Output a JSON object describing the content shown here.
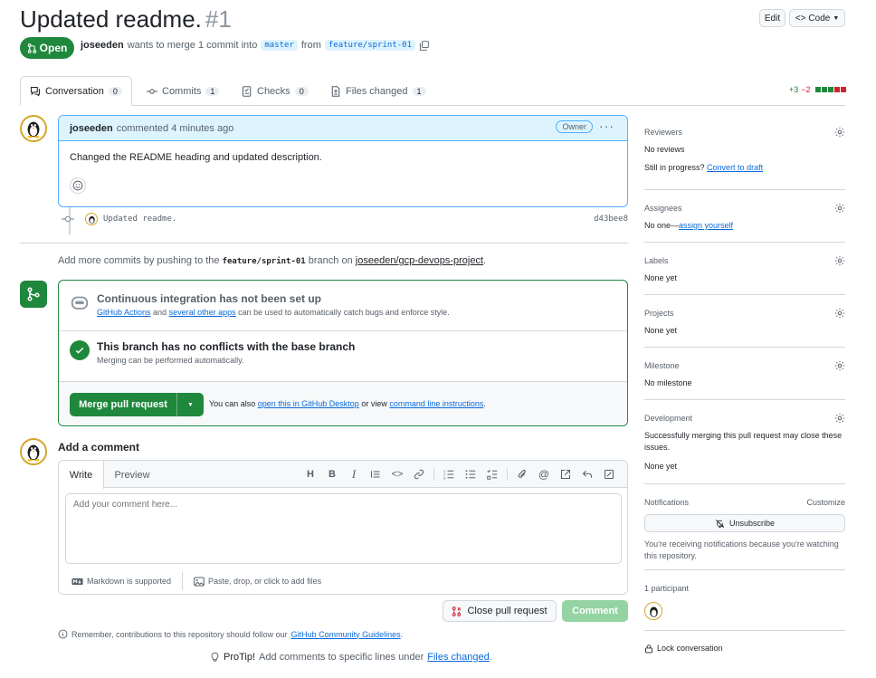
{
  "header": {
    "title": "Updated readme.",
    "number": "#1",
    "edit_label": "Edit",
    "code_label": "Code",
    "state": "Open",
    "author": "joseeden",
    "merge_text_1": "wants to merge 1 commit into",
    "base_branch": "master",
    "merge_text_2": "from",
    "head_branch": "feature/sprint-01"
  },
  "tabs": [
    {
      "label": "Conversation",
      "count": "0"
    },
    {
      "label": "Commits",
      "count": "1"
    },
    {
      "label": "Checks",
      "count": "0"
    },
    {
      "label": "Files changed",
      "count": "1"
    }
  ],
  "diffstat": {
    "additions": "+3",
    "deletions": "−2"
  },
  "comment": {
    "author": "joseeden",
    "time": "commented 4 minutes ago",
    "badge": "Owner",
    "body": "Changed the README heading and updated description."
  },
  "commit": {
    "message": "Updated readme.",
    "sha": "d43bee8"
  },
  "push_note": {
    "text_1": "Add more commits by pushing to the",
    "branch": "feature/sprint-01",
    "text_2": "branch on",
    "repo": "joseeden/gcp-devops-project",
    "text_3": "."
  },
  "merge_box": {
    "ci_title": "Continuous integration has not been set up",
    "ci_link_1": "GitHub Actions",
    "ci_and": "and",
    "ci_link_2": "several other apps",
    "ci_rest": "can be used to automatically catch bugs and enforce style.",
    "conflict_title": "This branch has no conflicts with the base branch",
    "conflict_sub": "Merging can be performed automatically.",
    "merge_button": "Merge pull request",
    "alt_1": "You can also",
    "alt_link_1": "open this in GitHub Desktop",
    "alt_2": "or view",
    "alt_link_2": "command line instructions",
    "alt_3": "."
  },
  "add_comment": {
    "title": "Add a comment",
    "tab_write": "Write",
    "tab_preview": "Preview",
    "placeholder": "Add your comment here...",
    "markdown_note": "Markdown is supported",
    "attach_note": "Paste, drop, or click to add files",
    "close_button": "Close pull request",
    "comment_button": "Comment",
    "guideline_1": "Remember, contributions to this repository should follow our",
    "guideline_link": "GitHub Community Guidelines",
    "guideline_2": ".",
    "protip_label": "ProTip!",
    "protip_text": "Add comments to specific lines under",
    "protip_link": "Files changed",
    "protip_end": "."
  },
  "sidebar": {
    "reviewers": {
      "label": "Reviewers",
      "value": "No reviews",
      "progress_text": "Still in progress?",
      "progress_link": "Convert to draft"
    },
    "assignees": {
      "label": "Assignees",
      "value": "No one—",
      "link": "assign yourself"
    },
    "labels": {
      "label": "Labels",
      "value": "None yet"
    },
    "projects": {
      "label": "Projects",
      "value": "None yet"
    },
    "milestone": {
      "label": "Milestone",
      "value": "No milestone"
    },
    "development": {
      "label": "Development",
      "description": "Successfully merging this pull request may close these issues.",
      "value": "None yet"
    },
    "notifications": {
      "label": "Notifications",
      "customize": "Customize",
      "button": "Unsubscribe",
      "note": "You're receiving notifications because you're watching this repository."
    },
    "participants": {
      "label": "1 participant"
    },
    "lock": {
      "label": "Lock conversation"
    }
  },
  "colors": {
    "accent": "#0969da",
    "success": "#1f883d",
    "danger": "#cf222e",
    "highlight": "#ddf4ff"
  }
}
